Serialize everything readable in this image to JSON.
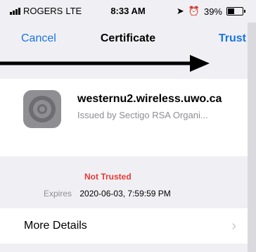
{
  "status_bar": {
    "carrier": "ROGERS",
    "network": "LTE",
    "time": "8:33 AM",
    "battery": "39%",
    "battery_level": 0.39
  },
  "nav": {
    "cancel_label": "Cancel",
    "title": "Certificate",
    "trust_label": "Trust"
  },
  "certificate": {
    "hostname": "westernu2.wireless.uwo.ca",
    "issuer": "Issued by Sectigo RSA Organi...",
    "status": "Not Trusted",
    "expires_label": "Expires",
    "expires_value": "2020-06-03, 7:59:59 PM"
  },
  "more_details": {
    "label": "More Details"
  },
  "colors": {
    "accent": "#1a73e8",
    "danger": "#e53935",
    "muted": "#8e8e93"
  }
}
